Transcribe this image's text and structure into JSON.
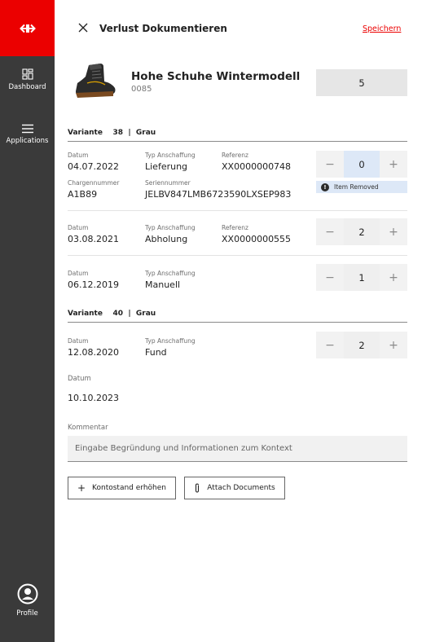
{
  "sidebar": {
    "logo_icon": "sbb-logo-icon",
    "items": [
      {
        "label": "Dashboard",
        "icon": "dashboard-icon"
      },
      {
        "label": "Applications",
        "icon": "menu-icon"
      }
    ],
    "profile": {
      "label": "Profile",
      "icon": "profile-icon"
    }
  },
  "header": {
    "title": "Verlust Dokumentieren",
    "save_label": "Speichern",
    "close_icon": "close-icon"
  },
  "product": {
    "name": "Hohe Schuhe Wintermodell",
    "code": "0085",
    "total": "5"
  },
  "variants": [
    {
      "label": "Variante",
      "size": "38",
      "color": "Grau",
      "entries": [
        {
          "datum_label": "Datum",
          "datum": "04.07.2022",
          "typ_label": "Typ Anschaffung",
          "typ": "Lieferung",
          "ref_label": "Referenz",
          "ref": "XX0000000748",
          "charge_label": "Chargennummer",
          "charge": "A1B89",
          "serial_label": "Seriennummer",
          "serial": "JELBV847LMB6723590LXSEP983",
          "qty": "0",
          "notice": "Item Removed"
        },
        {
          "datum_label": "Datum",
          "datum": "03.08.2021",
          "typ_label": "Typ Anschaffung",
          "typ": "Abholung",
          "ref_label": "Referenz",
          "ref": "XX0000000555",
          "qty": "2"
        },
        {
          "datum_label": "Datum",
          "datum": "06.12.2019",
          "typ_label": "Typ Anschaffung",
          "typ": "Manuell",
          "qty": "1"
        }
      ]
    },
    {
      "label": "Variante",
      "size": "40",
      "color": "Grau",
      "entries": [
        {
          "datum_label": "Datum",
          "datum": "12.08.2020",
          "typ_label": "Typ Anschaffung",
          "typ": "Fund",
          "qty": "2"
        }
      ]
    }
  ],
  "datum_section": {
    "label": "Datum",
    "value": "10.10.2023"
  },
  "comment": {
    "label": "Kommentar",
    "placeholder": "Eingabe Begründung und Informationen zum Kontext"
  },
  "actions": {
    "increase_label": "Kontostand erhöhen",
    "attach_label": "Attach Documents"
  },
  "stepper": {
    "minus": "−",
    "plus": "+"
  },
  "colors": {
    "brand": "#eb0000",
    "sidebar": "#3a3a3a",
    "highlight": "#dde8f7"
  }
}
